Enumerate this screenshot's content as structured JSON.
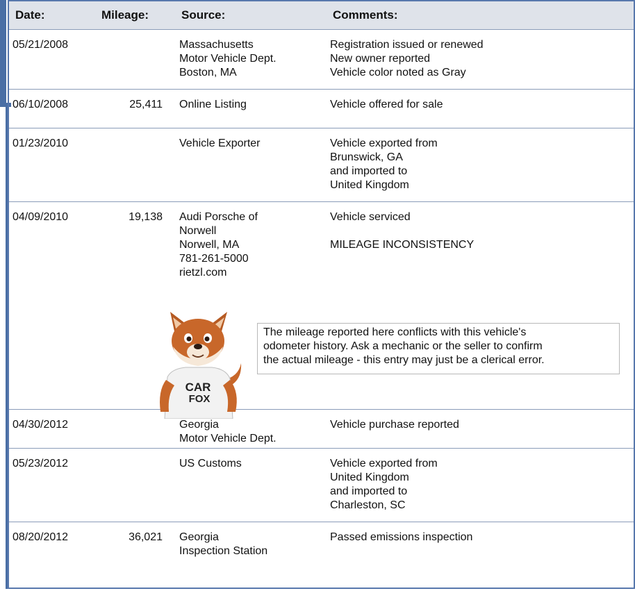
{
  "header": {
    "date": "Date:",
    "mileage": "Mileage:",
    "source": "Source:",
    "comments": "Comments:"
  },
  "records": [
    {
      "date": "05/21/2008",
      "mileage": "",
      "source": [
        "Massachusetts",
        "Motor Vehicle Dept.",
        "Boston, MA"
      ],
      "comments": [
        "Registration issued or renewed",
        "New owner reported",
        "Vehicle color noted as Gray"
      ]
    },
    {
      "date": "06/10/2008",
      "mileage": "25,411",
      "source": [
        "Online Listing"
      ],
      "comments": [
        "Vehicle offered for sale"
      ]
    },
    {
      "date": "01/23/2010",
      "mileage": "",
      "source": [
        "Vehicle Exporter"
      ],
      "comments": [
        "Vehicle exported from",
        "Brunswick, GA",
        "and imported to",
        "United Kingdom"
      ]
    },
    {
      "date": "04/09/2010",
      "mileage": "19,138",
      "source": [
        "Audi Porsche of",
        "Norwell",
        "Norwell, MA",
        "781-261-5000",
        "rietzl.com"
      ],
      "comments": [
        "Vehicle serviced",
        "",
        "MILEAGE INCONSISTENCY"
      ]
    },
    {
      "date": "04/30/2012",
      "mileage": "",
      "source": [
        "Georgia",
        "Motor Vehicle Dept."
      ],
      "comments": [
        "Vehicle purchase reported"
      ]
    },
    {
      "date": "05/23/2012",
      "mileage": "",
      "source": [
        "US Customs"
      ],
      "comments": [
        "Vehicle exported from",
        "United Kingdom",
        "and imported to",
        "Charleston, SC"
      ]
    },
    {
      "date": "08/20/2012",
      "mileage": "36,021",
      "source": [
        "Georgia",
        "Inspection Station"
      ],
      "comments": [
        "Passed emissions inspection"
      ]
    }
  ],
  "alert": {
    "lines": [
      "The mileage reported here conflicts with this vehicle's",
      "odometer history. Ask a mechanic or the seller to confirm",
      "the actual mileage - this entry may just be a clerical error."
    ]
  },
  "mascot": {
    "shirt_line1": "CAR",
    "shirt_line2": "FOX",
    "icon": "carfox-mascot-icon"
  },
  "colors": {
    "border": "#5878ad",
    "header_bg": "#dfe3ea",
    "row_divider": "#8a9cb8",
    "fox_orange": "#c8672a"
  }
}
